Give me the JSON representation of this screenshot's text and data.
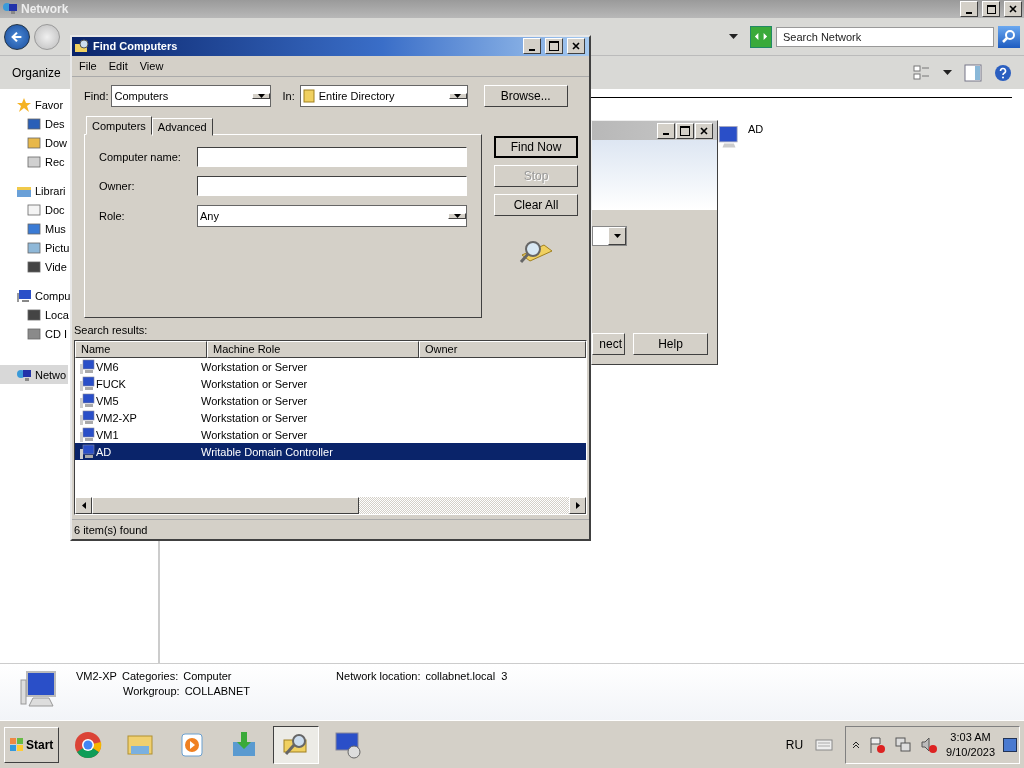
{
  "explorer": {
    "title": "Network",
    "search": {
      "placeholder": "Search Network"
    },
    "toolbar": {
      "organize": "Organize"
    },
    "sidebar": [
      {
        "label": "Favor",
        "selected": false,
        "children": [
          {
            "label": "Des",
            "selected": false
          },
          {
            "label": "Dow",
            "selected": false
          },
          {
            "label": "Rec",
            "selected": false
          }
        ]
      },
      {
        "label": "Librari",
        "selected": false,
        "children": [
          {
            "label": "Doc",
            "selected": false
          },
          {
            "label": "Mus",
            "selected": false
          },
          {
            "label": "Pictu",
            "selected": false
          },
          {
            "label": "Vide",
            "selected": false
          }
        ]
      },
      {
        "label": "Compu",
        "selected": false,
        "children": [
          {
            "label": "Loca",
            "selected": false
          },
          {
            "label": "CD I",
            "selected": false
          }
        ]
      },
      {
        "label": "Netwo",
        "selected": true
      }
    ],
    "items": [
      {
        "name": "AD"
      }
    ],
    "details": {
      "name": "VM2-XP",
      "categories_label": "Categories:",
      "categories": "Computer",
      "workgroup_label": "Workgroup:",
      "workgroup": "COLLABNET",
      "location_label": "Network location:",
      "location": "collabnet.local  3"
    }
  },
  "back_dialog": {
    "buttons": [
      {
        "label": "nect"
      },
      {
        "label": "Help"
      }
    ]
  },
  "find_dialog": {
    "title": "Find Computers",
    "menu": [
      "File",
      "Edit",
      "View"
    ],
    "find_label": "Find:",
    "find_value": "Computers",
    "in_label": "In:",
    "in_value": "Entire Directory",
    "browse": "Browse...",
    "tabs": [
      {
        "label": "Computers",
        "selected": true
      },
      {
        "label": "Advanced",
        "selected": false
      }
    ],
    "fields": [
      {
        "label": "Computer name:",
        "kind": "text"
      },
      {
        "label": "Owner:",
        "kind": "text"
      },
      {
        "label": "Role:",
        "kind": "select",
        "value": "Any"
      }
    ],
    "actions": [
      {
        "label": "Find Now",
        "disabled": false
      },
      {
        "label": "Stop",
        "disabled": true
      },
      {
        "label": "Clear All",
        "disabled": false
      }
    ],
    "results_label": "Search results:",
    "columns": [
      "Name",
      "Machine Role",
      "Owner"
    ],
    "rows": [
      {
        "name": "VM6",
        "role": "Workstation or Server",
        "selected": false
      },
      {
        "name": "FUCK",
        "role": "Workstation or Server",
        "selected": false
      },
      {
        "name": "VM5",
        "role": "Workstation or Server",
        "selected": false
      },
      {
        "name": "VM2-XP",
        "role": "Workstation or Server",
        "selected": false
      },
      {
        "name": "VM1",
        "role": "Workstation or Server",
        "selected": false
      },
      {
        "name": "AD",
        "role": "Writable Domain Controller",
        "selected": true
      }
    ],
    "status": "6 item(s) found"
  },
  "taskbar": {
    "start": "Start",
    "apps": [
      {
        "selected": false
      },
      {
        "selected": false
      },
      {
        "selected": false
      },
      {
        "selected": false
      },
      {
        "selected": true
      },
      {
        "selected": false
      }
    ],
    "language": "RU",
    "time": "3:03 AM",
    "date": "9/10/2023"
  }
}
